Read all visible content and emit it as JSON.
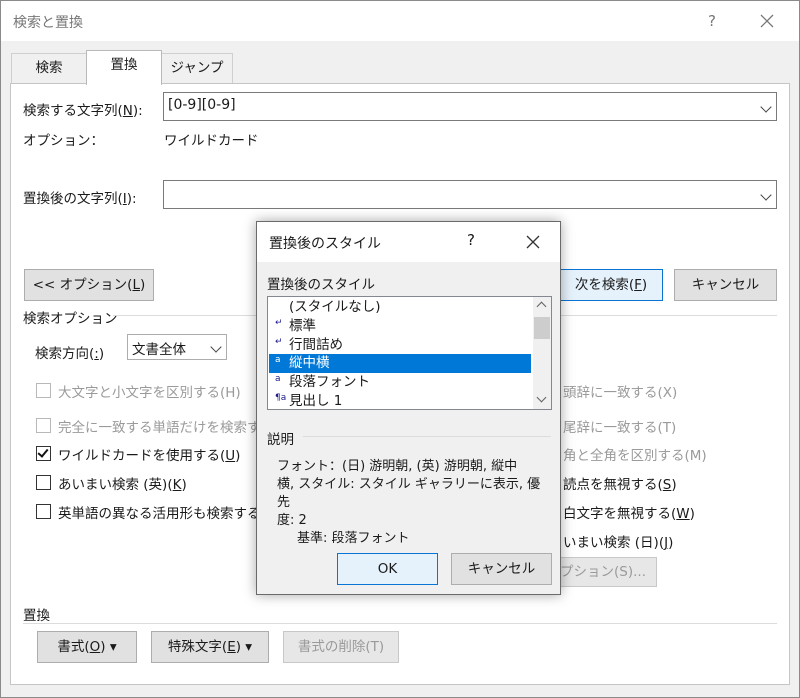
{
  "window": {
    "title": "検索と置換",
    "help": "?",
    "close_icon": "close-icon"
  },
  "tabs": [
    {
      "label": "検索",
      "active": false
    },
    {
      "label": "置換",
      "active": true
    },
    {
      "label": "ジャンプ",
      "active": false
    }
  ],
  "find": {
    "label": "検索する文字列(",
    "label_key": "N",
    "label_end": "):",
    "value": "[0-9][0-9]",
    "options_label": "オプション：",
    "options_value": "ワイルドカード"
  },
  "replace": {
    "label": "置換後の文字列(",
    "label_key": "I",
    "label_end": "):",
    "value": ""
  },
  "buttons": {
    "less_options": "<< オプション(",
    "less_options_key": "L",
    "less_options_end": ")",
    "find_next": "次を検索(",
    "find_next_key": "F",
    "find_next_end": ")",
    "cancel": "キャンセル",
    "more_options_fragment": "プション(S)..."
  },
  "search_options": {
    "heading": "検索オプション",
    "direction_label": "検索方向(",
    "direction_key": ":",
    "direction_end": ")",
    "direction_value": "文書全体",
    "left": [
      {
        "label": "大文字と小文字を区別する(H)",
        "checked": false,
        "disabled": true
      },
      {
        "label": "完全に一致する単語だけを検索す",
        "checked": false,
        "disabled": true
      },
      {
        "label": "ワイルドカードを使用する(",
        "key": "U",
        "end": ")",
        "checked": true,
        "disabled": false
      },
      {
        "label": "あいまい検索 (英)(",
        "key": "K",
        "end": ")",
        "checked": false,
        "disabled": false
      },
      {
        "label": "英単語の異なる活用形も検索する",
        "checked": false,
        "disabled": false
      }
    ],
    "right": [
      {
        "label": "頭辞に一致する(X)",
        "disabled": true
      },
      {
        "label": "尾辞に一致する(T)",
        "disabled": true
      },
      {
        "label": "角と全角を区別する(M)",
        "disabled": true
      },
      {
        "label": "読点を無視する(",
        "key": "S",
        "end": ")",
        "disabled": false
      },
      {
        "label": "白文字を無視する(",
        "key": "W",
        "end": ")",
        "disabled": false
      },
      {
        "label": "いまい検索 (日)(",
        "key": "J",
        "end": ")",
        "disabled": false
      }
    ]
  },
  "replace_section": {
    "heading": "置換",
    "format": "書式(",
    "format_key": "O",
    "format_end": ") ▾",
    "special": "特殊文字(",
    "special_key": "E",
    "special_end": ") ▾",
    "no_format": "書式の削除(T)"
  },
  "modal": {
    "title": "置換後のスタイル",
    "help": "?",
    "list_label": "置換後のスタイル",
    "styles": [
      {
        "marker": "",
        "name": "(スタイルなし)",
        "selected": false
      },
      {
        "marker": "↵",
        "name": "標準",
        "selected": false
      },
      {
        "marker": "↵",
        "name": "行間詰め",
        "selected": false
      },
      {
        "marker": "a",
        "name": "縦中横",
        "selected": true
      },
      {
        "marker": "a",
        "name": "段落フォント",
        "selected": false
      },
      {
        "marker": "¶a",
        "name": "見出し 1",
        "selected": false
      }
    ],
    "desc_label": "説明",
    "description_1": "フォント：(日) 游明朝, (英) 游明朝, 縦中",
    "description_2": "横, スタイル: スタイル ギャラリーに表示, 優先",
    "description_3": "度: 2",
    "description_4": "基準: 段落フォント",
    "ok": "OK",
    "cancel": "キャンセル"
  }
}
